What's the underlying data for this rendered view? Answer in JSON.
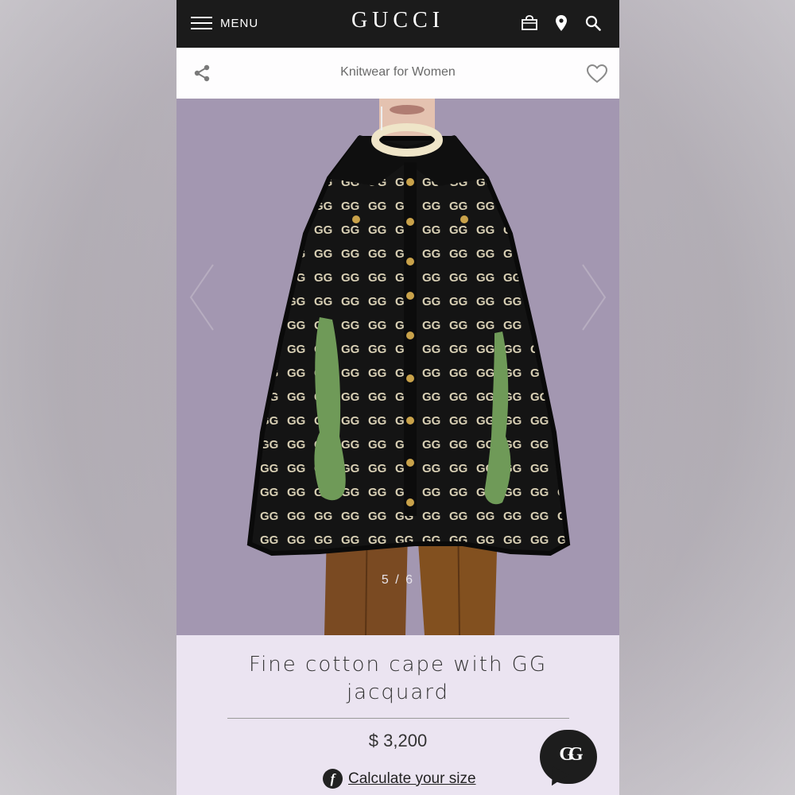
{
  "header": {
    "menu_label": "MENU",
    "logo": "GUCCI",
    "icons": [
      "shopping-bag-icon",
      "location-pin-icon",
      "search-icon"
    ]
  },
  "subheader": {
    "title": "Knitwear for Women",
    "share_icon": "share-icon",
    "wishlist_icon": "heart-icon"
  },
  "gallery": {
    "counter": "5 / 6",
    "current": 5,
    "total": 6,
    "image_description": "Model wearing black GG jacquard cape with gold buttons, green gloves, brown leather trousers, pearl necklace",
    "background_color": "#a397b1"
  },
  "product": {
    "title": "Fine cotton cape with GG jacquard",
    "price": "$ 3,200",
    "size_link": "Calculate your size",
    "size_link_icon": "f"
  },
  "chat": {
    "icon": "GG",
    "icon_name": "gucci-chat-icon"
  },
  "colors": {
    "header_bg": "#1b1b1b",
    "info_bg": "#ebe4f1",
    "text": "#333333"
  }
}
